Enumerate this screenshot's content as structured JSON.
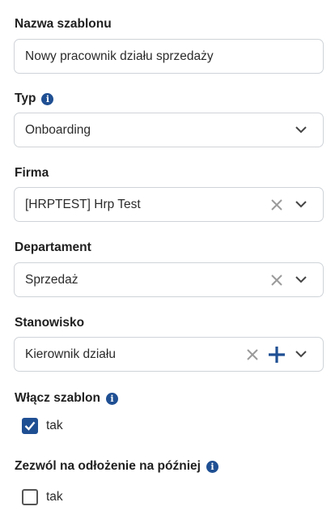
{
  "template_name": {
    "label": "Nazwa szablonu",
    "value": "Nowy pracownik działu sprzedaży"
  },
  "type": {
    "label": "Typ",
    "info_icon": "info-icon",
    "value": "Onboarding"
  },
  "company": {
    "label": "Firma",
    "value": "[HRPTEST] Hrp Test"
  },
  "department": {
    "label": "Departament",
    "value": "Sprzedaż"
  },
  "position": {
    "label": "Stanowisko",
    "value": "Kierownik działu"
  },
  "enable_template": {
    "label": "Włącz szablon",
    "option_label": "tak",
    "checked": true
  },
  "allow_postpone": {
    "label": "Zezwól na odłożenie na później",
    "option_label": "tak",
    "checked": false
  },
  "colors": {
    "accent": "#1f4f93",
    "border": "#cfd3d8",
    "icon_gray": "#9a9a9a"
  }
}
